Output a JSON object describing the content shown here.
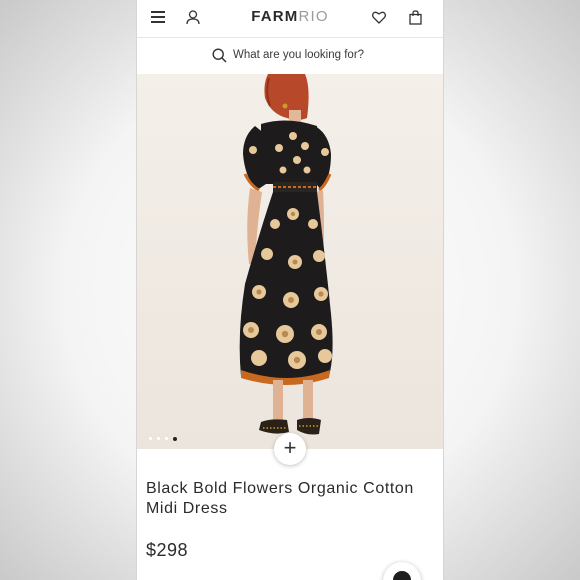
{
  "header": {
    "logo_bold": "FARM",
    "logo_light": "RIO",
    "icons": [
      "menu-icon",
      "account-icon",
      "heart-icon",
      "bag-icon"
    ]
  },
  "search": {
    "placeholder": "What are you looking for?",
    "icon": "search-icon"
  },
  "gallery": {
    "image_count": 4,
    "active_index": 3
  },
  "product": {
    "name": "Black Bold Flowers Organic Cotton Midi Dress",
    "price": "$298",
    "add_symbol": "+"
  },
  "colors": {
    "dress": "#1d1b1c",
    "flower": "#e6c89a",
    "accent": "#c8691f",
    "text": "#2b2b2b"
  }
}
